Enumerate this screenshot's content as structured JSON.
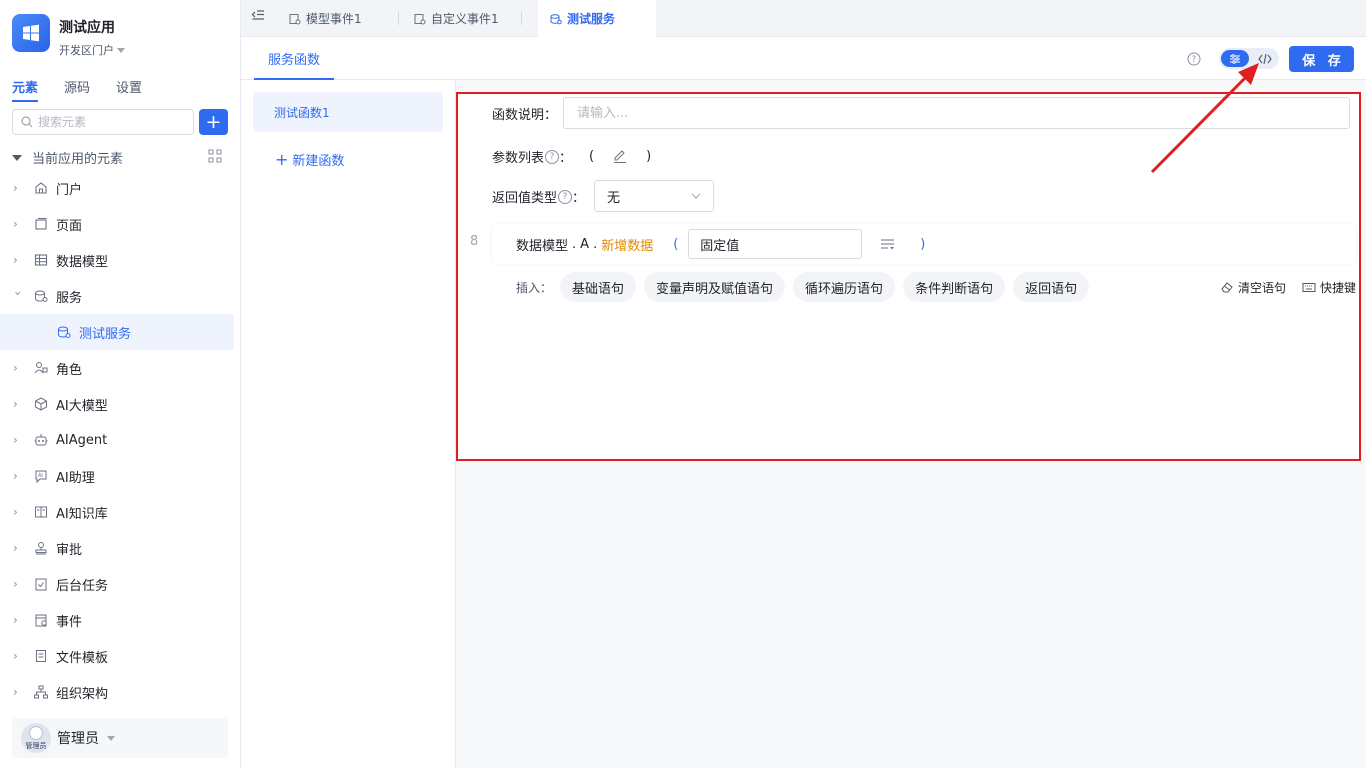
{
  "app": {
    "name": "测试应用",
    "portal": "开发区门户"
  },
  "sidebar": {
    "tabs": [
      {
        "label": "元素"
      },
      {
        "label": "源码"
      },
      {
        "label": "设置"
      }
    ],
    "search_placeholder": "搜索元素",
    "section_title": "当前应用的元素",
    "items": [
      {
        "label": "门户",
        "icon": "home-icon"
      },
      {
        "label": "页面",
        "icon": "page-icon"
      },
      {
        "label": "数据模型",
        "icon": "table-icon"
      },
      {
        "label": "服务",
        "icon": "service-icon"
      },
      {
        "label": "测试服务",
        "icon": "service-icon"
      },
      {
        "label": "角色",
        "icon": "role-icon"
      },
      {
        "label": "AI大模型",
        "icon": "cube-icon"
      },
      {
        "label": "AIAgent",
        "icon": "robot-icon"
      },
      {
        "label": "AI助理",
        "icon": "ai-assistant-icon"
      },
      {
        "label": "AI知识库",
        "icon": "book-icon"
      },
      {
        "label": "审批",
        "icon": "stamp-icon"
      },
      {
        "label": "后台任务",
        "icon": "task-icon"
      },
      {
        "label": "事件",
        "icon": "event-icon"
      },
      {
        "label": "文件模板",
        "icon": "file-template-icon"
      },
      {
        "label": "组织架构",
        "icon": "org-icon"
      }
    ],
    "user": {
      "name": "管理员",
      "avatar_tag": "管理员"
    }
  },
  "top_tabs": [
    {
      "label": "模型事件1"
    },
    {
      "label": "自定义事件1"
    },
    {
      "label": "测试服务"
    }
  ],
  "toolbar": {
    "sub_tab": "服务函数",
    "save_label": "保 存"
  },
  "functions": {
    "items": [
      {
        "label": "测试函数1"
      }
    ],
    "new_label": "新建函数"
  },
  "editor": {
    "desc_label": "函数说明：",
    "desc_placeholder": "请输入...",
    "params_label": "参数列表",
    "params_colon": "：",
    "paren_open": "(",
    "paren_close": ")",
    "return_label": "返回值类型",
    "return_colon": "：",
    "return_value": "无",
    "statement": {
      "line_no": "8",
      "model": "数据模型",
      "dot": ".",
      "entity": "A",
      "method": "新增数据",
      "value": "固定值"
    },
    "insert_label": "插入：",
    "insert_chips": [
      "基础语句",
      "变量声明及赋值语句",
      "循环遍历语句",
      "条件判断语句",
      "返回语句"
    ],
    "clear_label": "清空语句",
    "shortcut_label": "快捷键"
  },
  "colors": {
    "accent": "#2f6bf0",
    "method": "#e08a00",
    "annotation": "#e02020"
  }
}
